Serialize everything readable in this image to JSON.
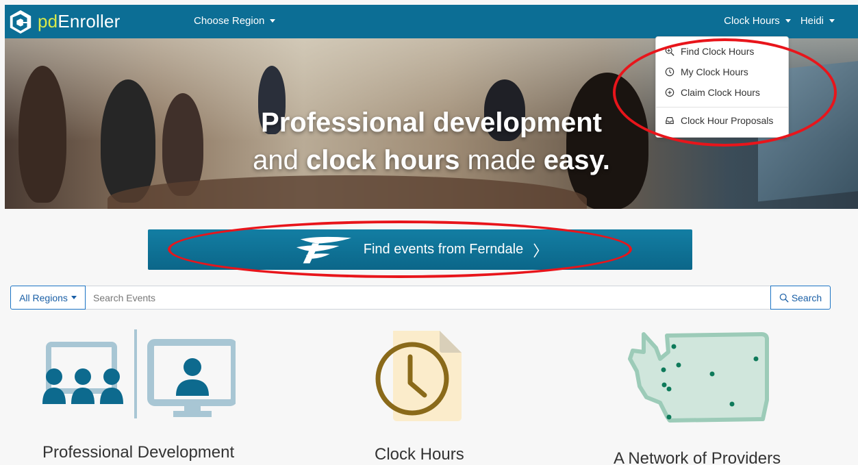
{
  "navbar": {
    "brand_prefix": "pd",
    "brand_suffix": "Enroller",
    "region_label": "Choose Region",
    "clock_hours_label": "Clock Hours",
    "user_label": "Heidi"
  },
  "dropdown": {
    "items": [
      {
        "label": "Find Clock Hours",
        "icon": "zoom-in-icon"
      },
      {
        "label": "My Clock Hours",
        "icon": "clock-icon"
      },
      {
        "label": "Claim Clock Hours",
        "icon": "plus-circle-icon"
      },
      {
        "label": "Clock Hour Proposals",
        "icon": "inbox-icon"
      }
    ]
  },
  "hero": {
    "line1": "Professional development",
    "line2_a": "and ",
    "line2_b": "clock hours",
    "line2_c": " made ",
    "line2_d": "easy."
  },
  "find_button": {
    "label": "Find events from Ferndale",
    "chevron": "〉"
  },
  "search": {
    "region_label": "All Regions",
    "placeholder": "Search Events",
    "button_label": "Search"
  },
  "features": [
    {
      "label": "Professional Development",
      "icon": "classroom-icon"
    },
    {
      "label": "Clock Hours",
      "icon": "clock-document-icon"
    },
    {
      "label": "A Network of Providers",
      "icon": "washington-map-icon"
    }
  ],
  "colors": {
    "navbar": "#0c6e95",
    "brand_accent": "#d9e94a",
    "annotation": "#e8151b",
    "primary": "#1a73c4"
  }
}
